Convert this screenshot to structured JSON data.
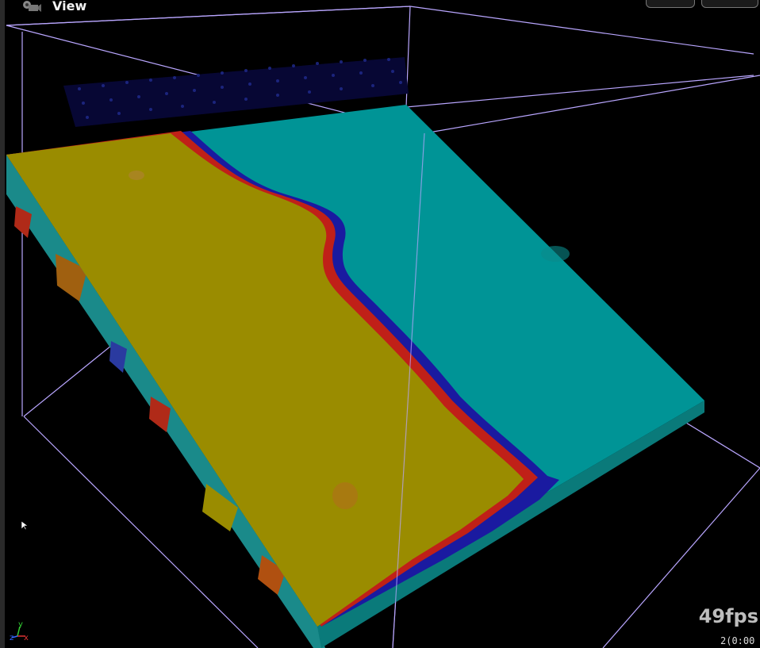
{
  "header": {
    "title": "View"
  },
  "overlay": {
    "fps": "49fps",
    "timecode": "2(0:00"
  },
  "axes": {
    "y": "y",
    "z": "z",
    "x": "x"
  },
  "colors": {
    "background": "#000000",
    "bounding_box": "#b9a6ff",
    "region_a": "#9a8c00",
    "region_b": "#009496",
    "boundary_red": "#c02018",
    "boundary_blue": "#1a1aa0",
    "particles": "#0a0a5a"
  }
}
